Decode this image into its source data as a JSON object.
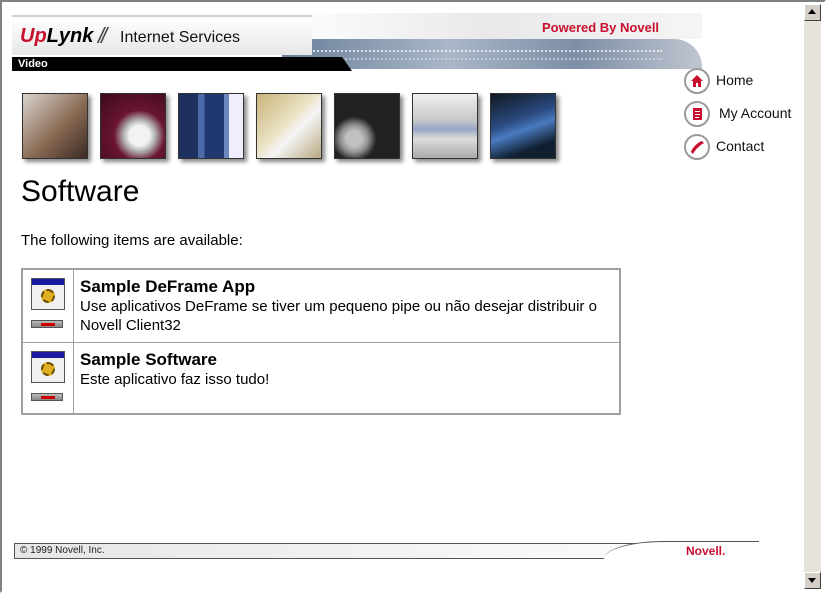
{
  "header": {
    "logo_up": "Up",
    "logo_lynk": "Lynk",
    "logo_sep": "//",
    "service_label": "Internet Services",
    "powered_by": "Powered By Novell",
    "section": "Video"
  },
  "nav": {
    "home": "Home",
    "account": "My Account",
    "contact": "Contact"
  },
  "page": {
    "title": "Software",
    "intro": "The following items are available:"
  },
  "apps": [
    {
      "name": "Sample DeFrame App",
      "description": "Use aplicativos DeFrame se tiver um pequeno pipe ou não desejar distribuir o Novell Client32"
    },
    {
      "name": "Sample Software",
      "description": "Este aplicativo faz isso tudo!"
    }
  ],
  "footer": {
    "copyright": "© 1999 Novell, Inc.",
    "brand": "Novell."
  },
  "colors": {
    "brand_red": "#c8102e",
    "video_bar": "#000000"
  },
  "thumbnails": [
    {
      "name": "hand-image"
    },
    {
      "name": "car-image"
    },
    {
      "name": "servers-image"
    },
    {
      "name": "documents-image"
    },
    {
      "name": "cd-image"
    },
    {
      "name": "computers-image"
    },
    {
      "name": "laptop-image"
    }
  ]
}
